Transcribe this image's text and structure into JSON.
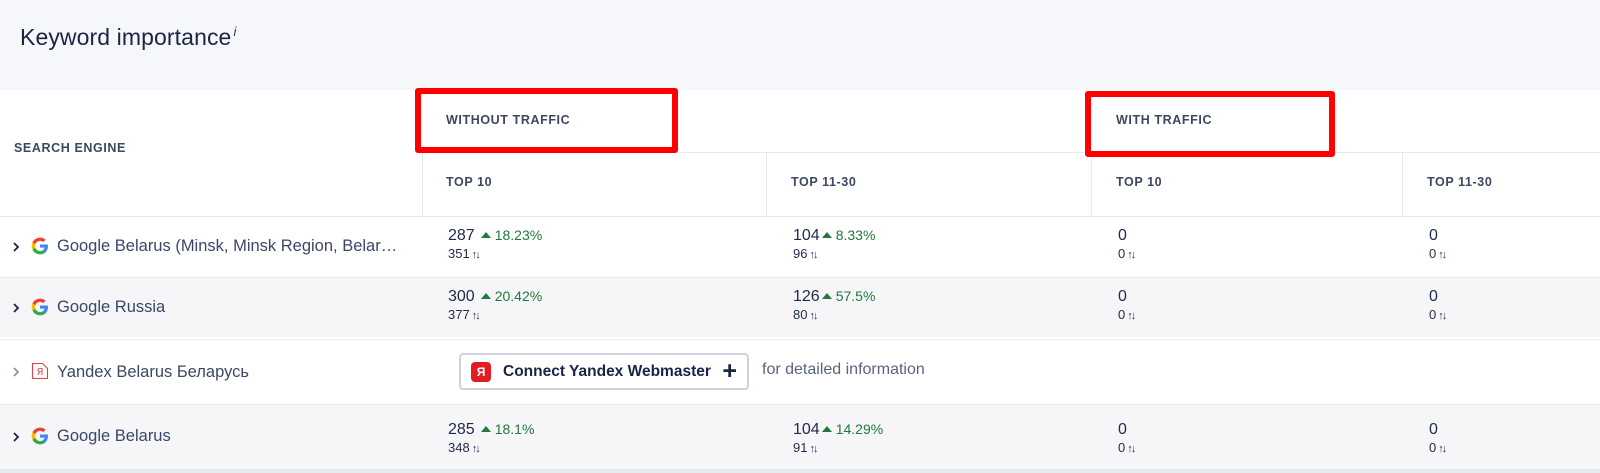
{
  "title": "Keyword importance",
  "title_info": "i",
  "headers": {
    "search_engine": "SEARCH ENGINE",
    "without_traffic": "WITHOUT TRAFFIC",
    "with_traffic": "WITH TRAFFIC",
    "top10": "TOP 10",
    "top11_30": "TOP 11-30"
  },
  "colors": {
    "highlight": "#ff0000",
    "positive": "#1f7a3e",
    "yandex_red": "#e31b23"
  },
  "rows": [
    {
      "engine": "Google Belarus (Minsk, Minsk Region, Belar…",
      "icon": "google-icon",
      "wo_top10": {
        "main": "287",
        "delta": "18.23%",
        "sub": "351"
      },
      "wo_top11": {
        "main": "104",
        "delta": "8.33%",
        "sub": "96"
      },
      "w_top10": {
        "main": "0",
        "sub": "0"
      },
      "w_top11": {
        "main": "0",
        "sub": "0"
      }
    },
    {
      "engine": "Google Russia",
      "icon": "google-icon",
      "wo_top10": {
        "main": "300",
        "delta": "20.42%",
        "sub": "377"
      },
      "wo_top11": {
        "main": "126",
        "delta": "57.5%",
        "sub": "80"
      },
      "w_top10": {
        "main": "0",
        "sub": "0"
      },
      "w_top11": {
        "main": "0",
        "sub": "0"
      }
    },
    {
      "engine": "Yandex Belarus Беларусь",
      "icon": "yandex-icon",
      "connect_label": "Connect Yandex Webmaster",
      "connect_badge": "Я",
      "detail_text": "for detailed information"
    },
    {
      "engine": "Google Belarus",
      "icon": "google-icon",
      "wo_top10": {
        "main": "285",
        "delta": "18.1%",
        "sub": "348"
      },
      "wo_top11": {
        "main": "104",
        "delta": "14.29%",
        "sub": "91"
      },
      "w_top10": {
        "main": "0",
        "sub": "0"
      },
      "w_top11": {
        "main": "0",
        "sub": "0"
      }
    }
  ]
}
